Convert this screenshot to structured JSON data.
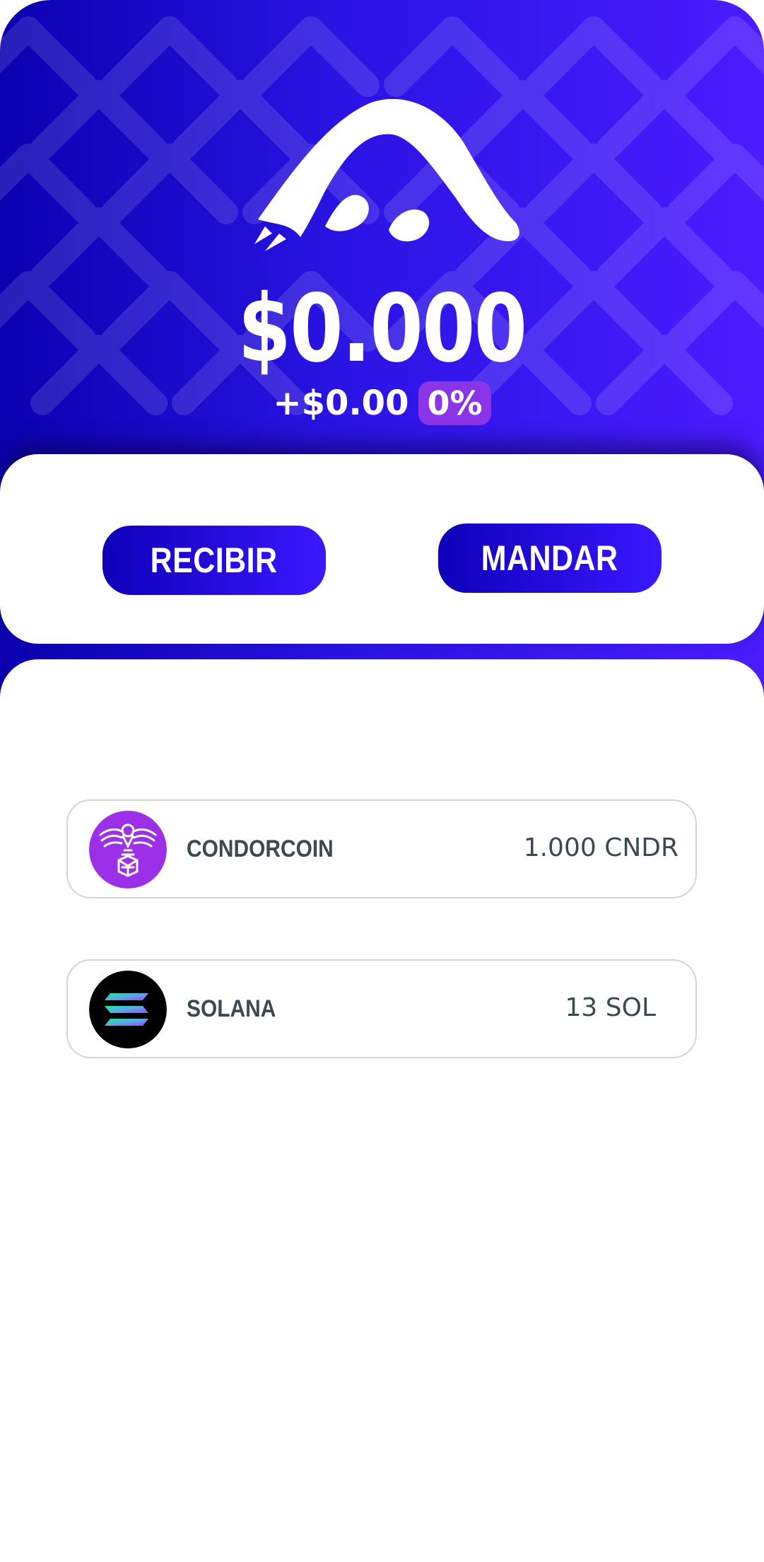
{
  "balance": {
    "total": "$0.000",
    "change_amount": "+$0.00",
    "change_percent": "0%"
  },
  "actions": {
    "receive_label": "RECIBIR",
    "send_label": "MANDAR"
  },
  "assets": [
    {
      "name": "CONDORCOIN",
      "amount": "1.000 CNDR",
      "icon": "condorcoin-icon",
      "icon_color": "#9b30e8"
    },
    {
      "name": "SOLANA",
      "amount": "13 SOL",
      "icon": "solana-icon",
      "icon_color": "#000000"
    }
  ],
  "theme": {
    "primary_dark": "#0b00b0",
    "primary_light": "#4a1cff",
    "badge_purple": "#8a35e8",
    "text_dark": "#3a4a52"
  }
}
